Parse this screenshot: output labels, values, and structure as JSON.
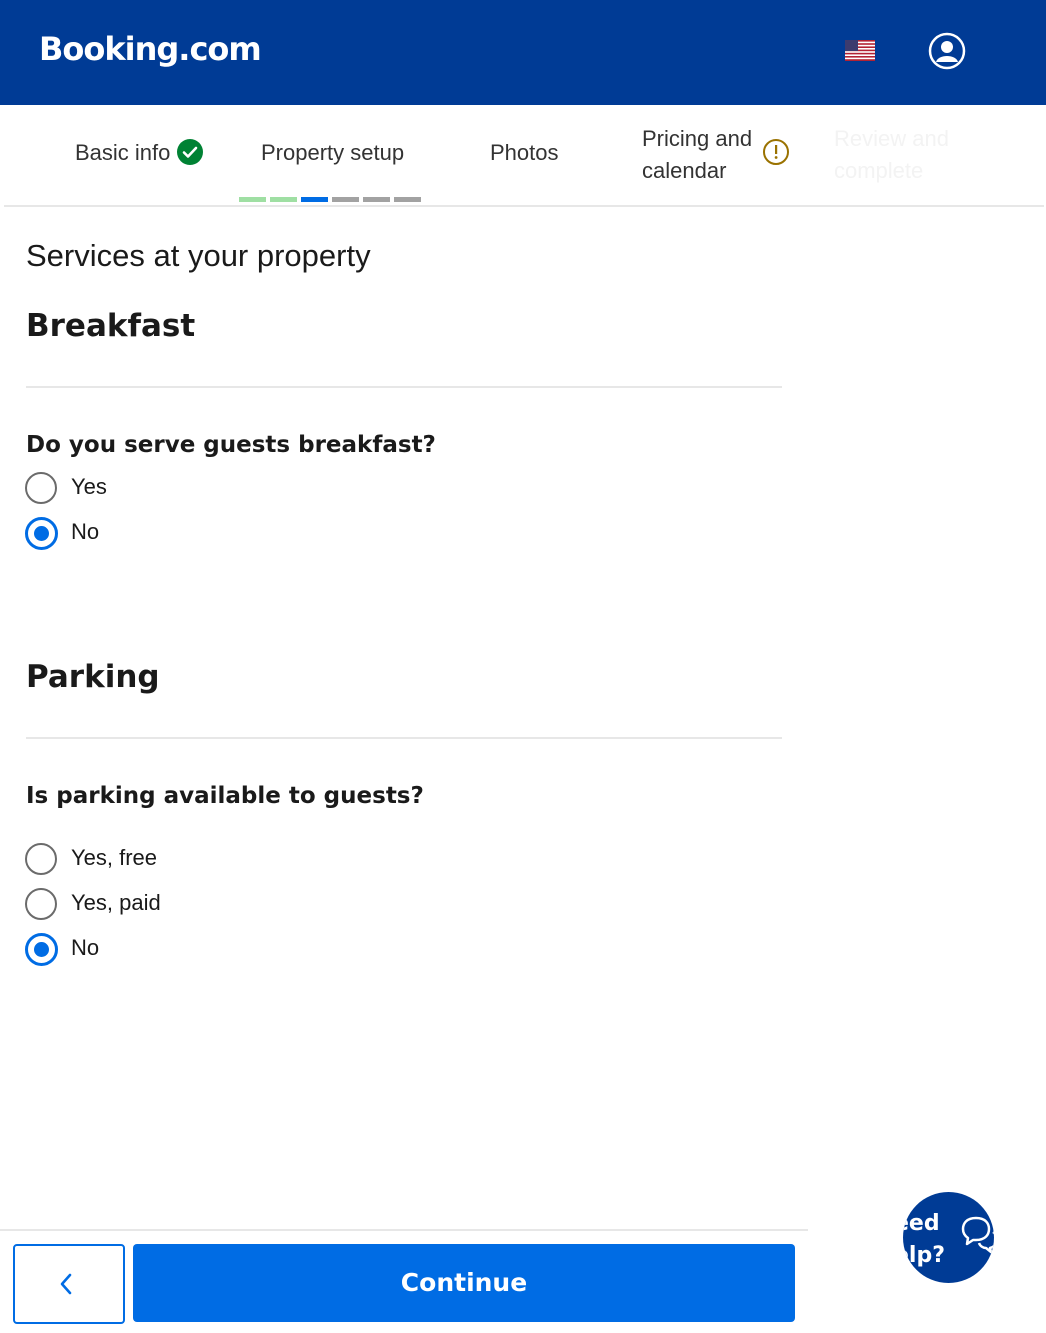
{
  "header": {
    "logo": "Booking.com",
    "flag_icon": "us-flag-icon",
    "account_icon": "account-icon"
  },
  "steps": [
    {
      "label": "Basic info",
      "status": "complete"
    },
    {
      "label": "Property setup",
      "status": "current"
    },
    {
      "label": "Photos",
      "status": "pending"
    },
    {
      "label": "Pricing and calendar",
      "status": "warning"
    },
    {
      "label": "Review and complete",
      "status": "disabled"
    }
  ],
  "progress": {
    "total_segments": 6,
    "completed": 2,
    "current": 3
  },
  "colors": {
    "brand": "#003b95",
    "accent": "#006ce4",
    "success": "#008234",
    "warning": "#9a7200",
    "done_segment": "#9fdfa3",
    "pending_segment": "#a2a2a2"
  },
  "page": {
    "title": "Services at your property"
  },
  "breakfast": {
    "heading": "Breakfast",
    "question": "Do you serve guests breakfast?",
    "options": [
      "Yes",
      "No"
    ],
    "selected": "No"
  },
  "parking": {
    "heading": "Parking",
    "question": "Is parking available to guests?",
    "options": [
      "Yes, free",
      "Yes, paid",
      "No"
    ],
    "selected": "No"
  },
  "footer": {
    "back_icon": "chevron-left-icon",
    "continue_label": "Continue"
  },
  "help": {
    "label": "Need\nhelp?",
    "visible_text": "eed\nelp?",
    "icon": "chat-bubbles-icon"
  }
}
